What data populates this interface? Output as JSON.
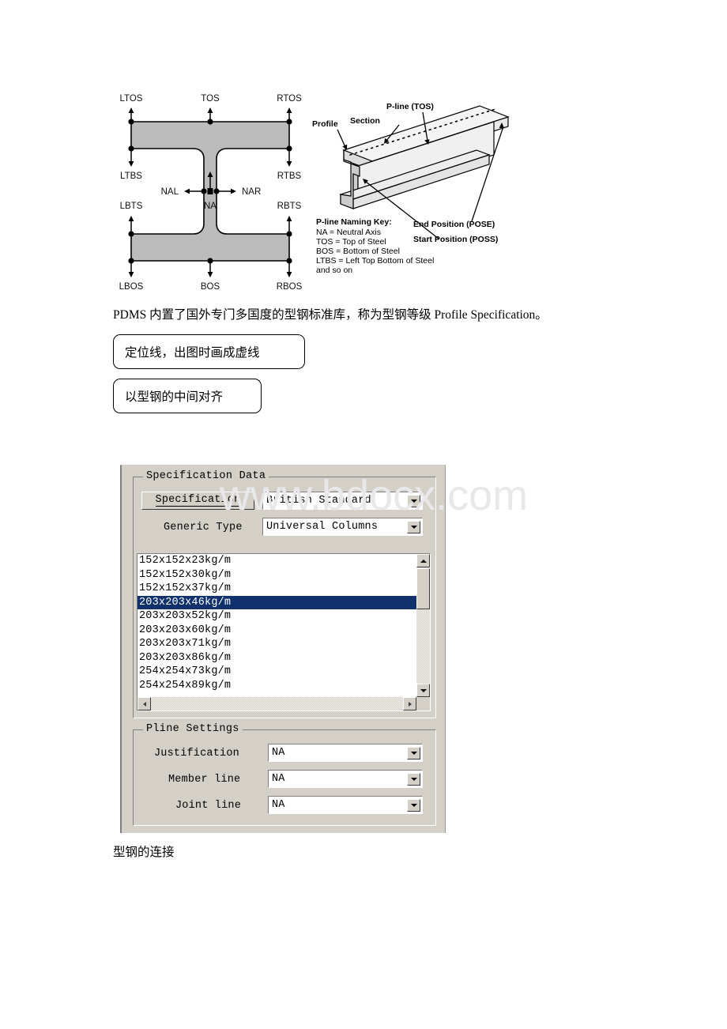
{
  "document": {
    "paragraph": "PDMS 内置了国外专门多国度的型钢标准库，称为型钢等级 Profile Specification。",
    "callouts": [
      "定位线，出图时画成虚线",
      "以型钢的中间对齐"
    ],
    "bottom_caption": "型钢的连接",
    "watermark": "www.bdocx.com"
  },
  "figure_left": {
    "name": "i-beam-pline-cross-section",
    "labels": {
      "ltos": "LTOS",
      "tos": "TOS",
      "rtos": "RTOS",
      "ltbs": "LTBS",
      "rtbs": "RTBS",
      "nal": "NAL",
      "na": "NA",
      "nar": "NAR",
      "lbts": "LBTS",
      "rbts": "RBTS",
      "lbos": "LBOS",
      "bos": "BOS",
      "rbos": "RBOS"
    },
    "fill_color": "#bbbbbb",
    "line_color": "#000000"
  },
  "figure_right": {
    "name": "beam-isometric-pline-diagram",
    "labels": {
      "pline_tos": "P-line (TOS)",
      "section": "Section",
      "profile": "Profile",
      "end_position": "End Position (POSE)",
      "start_position": "Start Position (POSS)"
    },
    "key_title": "P-line Naming Key:",
    "key_lines": [
      "NA = Neutral Axis",
      "TOS = Top of Steel",
      "BOS = Bottom of Steel",
      "LTBS = Left Top Bottom of Steel",
      "  and so on"
    ]
  },
  "dialog": {
    "background": "#d4d0c8",
    "specification_group": {
      "title": "Specification Data",
      "specification_button": "Specification",
      "specification_value": "British Standard",
      "generic_type_label": "Generic Type",
      "generic_type_value": "Universal Columns",
      "list_items": [
        "152x152x23kg/m",
        "152x152x30kg/m",
        "152x152x37kg/m",
        "203x203x46kg/m",
        "203x203x52kg/m",
        "203x203x60kg/m",
        "203x203x71kg/m",
        "203x203x86kg/m",
        "254x254x73kg/m",
        "254x254x89kg/m"
      ],
      "selected_index": 3,
      "selection_color": "#10316b"
    },
    "pline_group": {
      "title": "Pline Settings",
      "rows": [
        {
          "label": "Justification",
          "value": "NA"
        },
        {
          "label": "Member line",
          "value": "NA"
        },
        {
          "label": "Joint line",
          "value": "NA"
        }
      ]
    }
  }
}
